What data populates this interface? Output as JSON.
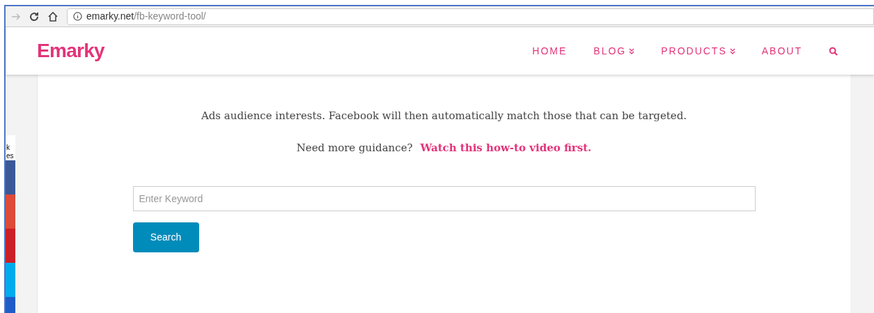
{
  "browser": {
    "url_domain": "emarky.net",
    "url_path": "/fb-keyword-tool/"
  },
  "header": {
    "logo": "Emarky",
    "nav": [
      {
        "label": "HOME",
        "dropdown": false
      },
      {
        "label": "BLOG",
        "dropdown": true
      },
      {
        "label": "PRODUCTS",
        "dropdown": true
      },
      {
        "label": "ABOUT",
        "dropdown": false
      }
    ]
  },
  "share_bar": {
    "count_lines": [
      "k",
      "es"
    ],
    "buttons": [
      {
        "color": "#3b5998"
      },
      {
        "color": "#dd4b39"
      },
      {
        "color": "#cb2027"
      },
      {
        "color": "#00aced"
      },
      {
        "color": "#1e5cc8"
      }
    ]
  },
  "content": {
    "intro": "Ads audience interests. Facebook will then automatically match those that can be targeted.",
    "guidance": "Need more guidance?",
    "guidance_link": "Watch this how-to video first.",
    "keyword_field": {
      "placeholder": "Enter Keyword"
    },
    "search_button": "Search"
  }
}
